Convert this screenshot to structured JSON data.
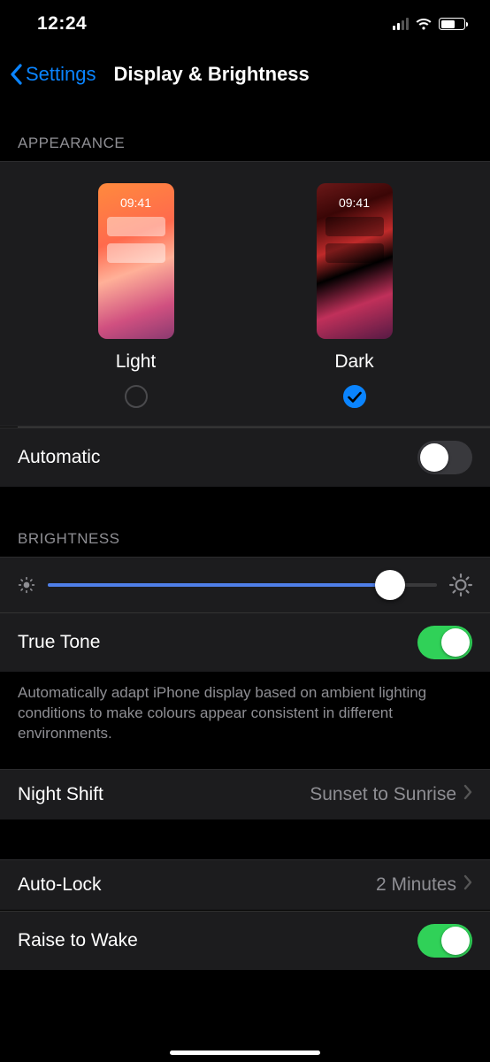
{
  "status": {
    "time": "12:24"
  },
  "nav": {
    "back": "Settings",
    "title": "Display & Brightness"
  },
  "appearance": {
    "header": "Appearance",
    "preview_time": "09:41",
    "light_label": "Light",
    "dark_label": "Dark",
    "selected": "dark",
    "automatic_label": "Automatic",
    "automatic_on": false
  },
  "brightness": {
    "header": "Brightness",
    "value_pct": 88,
    "truetone_label": "True Tone",
    "truetone_on": true,
    "truetone_footer": "Automatically adapt iPhone display based on ambient lighting conditions to make colours appear consistent in different environments."
  },
  "nightshift": {
    "label": "Night Shift",
    "detail": "Sunset to Sunrise"
  },
  "autolock": {
    "label": "Auto-Lock",
    "detail": "2 Minutes"
  },
  "raise": {
    "label": "Raise to Wake",
    "on": true
  }
}
